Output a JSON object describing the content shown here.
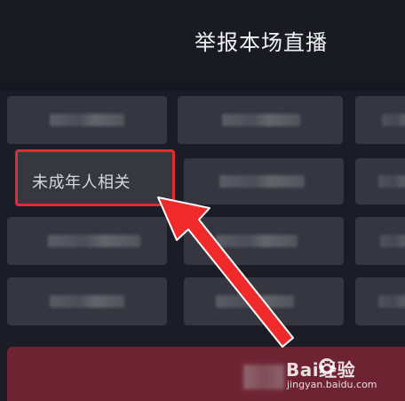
{
  "header": {
    "title": "举报本场直播"
  },
  "report_options": {
    "selected_label": "未成年人相关",
    "blurred_count": 11
  },
  "submit": {
    "label_blurred": true
  },
  "watermark": {
    "brand": "Bai经验",
    "paw_icon": "baidu-paw-icon",
    "url": "jingyan.baidu.com"
  },
  "annotation": {
    "color": "#e32d2d",
    "arrow_icon": "red-arrow-icon"
  }
}
